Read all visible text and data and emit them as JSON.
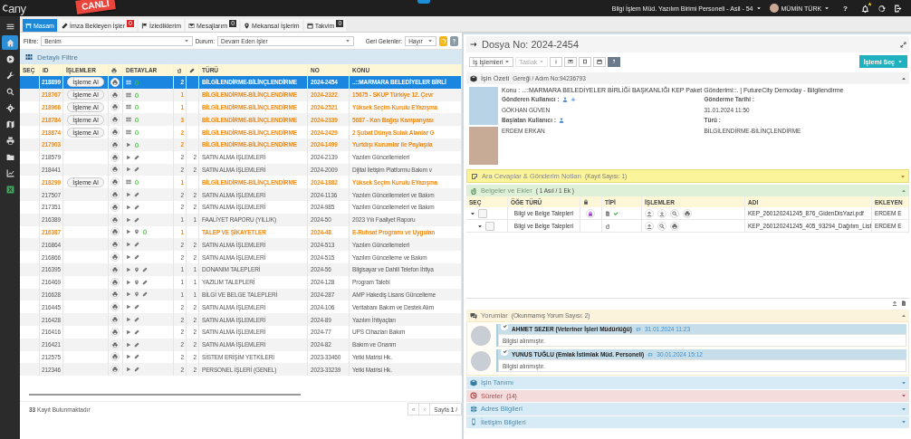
{
  "top_bar": {
    "logo_text": "any",
    "live_badge": "CANLI",
    "role": "Bilgi İşlem Müd. Yazılım Birimi Personeli - Asil - 54",
    "user": "MÜMİN TÜRK",
    "help": "?"
  },
  "sidebar": {
    "items": [
      {
        "kind": "menu",
        "selected": false
      },
      {
        "kind": "home",
        "selected": true
      },
      {
        "kind": "playc",
        "selected": false
      },
      {
        "kind": "wrench",
        "selected": false
      },
      {
        "kind": "search",
        "selected": false
      },
      {
        "kind": "gear",
        "selected": false
      },
      {
        "kind": "map",
        "selected": false
      },
      {
        "kind": "print",
        "selected": false
      },
      {
        "kind": "folder",
        "selected": false
      },
      {
        "kind": "chart",
        "selected": false
      },
      {
        "kind": "excel",
        "selected": false
      }
    ]
  },
  "tabs": [
    {
      "kind": "desk",
      "label": "Masam",
      "selected": true
    },
    {
      "kind": "pen",
      "label": "İmza Bekleyen İşler",
      "selected": false,
      "badge": {
        "text": "0",
        "color": "#e02424"
      }
    },
    {
      "kind": "flag",
      "label": "İzlediklerim",
      "selected": false
    },
    {
      "kind": "mail",
      "label": "Mesajlarım",
      "selected": false,
      "badge": {
        "text": "0",
        "color": "#333333"
      }
    },
    {
      "kind": "pin",
      "label": "Mekansal İşlerim",
      "selected": false
    },
    {
      "kind": "calendar",
      "label": "Takvim",
      "selected": false,
      "badge": {
        "text": "0",
        "color": "#333333"
      }
    }
  ],
  "filters": [
    {
      "label": "Filtre:",
      "value": "Benim"
    },
    {
      "label": "Durum:",
      "value": "Devam Eden İşler"
    },
    {
      "label": "Geri Gelenler:",
      "value": "Hayır"
    }
  ],
  "detail_filter": "Detaylı Filtre",
  "table": {
    "columns": [
      {
        "label": "SEÇ"
      },
      {
        "label": "ID"
      },
      {
        "label": "İŞLEMLER"
      },
      {
        "kind": "print"
      },
      {
        "label": "DETAYLAR"
      },
      {
        "kind": "clip"
      },
      {
        "kind": "pencil"
      },
      {
        "label": "TÜRÜ"
      },
      {
        "label": "NO"
      },
      {
        "label": "KONU"
      }
    ],
    "rows": [
      {
        "id": "218899",
        "action": "İşleme Al",
        "icons": [
          {
            "kind": "grid"
          },
          {
            "kind": "bell"
          }
        ],
        "count_1": "2",
        "type": "BİLGİLENDİRME-BİLİNÇLENDİRME",
        "no": "2024-2454",
        "subject": "..::MARMARA BELEDİYELER BİRLİ",
        "highlighted": true,
        "selected": true
      },
      {
        "id": "218767",
        "action": "İşleme Al",
        "icons": [
          {
            "kind": "grid"
          },
          {
            "kind": "bell"
          }
        ],
        "count_1": "1",
        "type": "BİLGİLENDİRME-BİLİNÇLENDİRME",
        "no": "2024-2322",
        "subject": "15675 - SKUP Türkiye 12. Çevr",
        "highlighted": true,
        "selected": false
      },
      {
        "id": "218966",
        "action": "İşleme Al",
        "icons": [
          {
            "kind": "grid"
          },
          {
            "kind": "bell"
          }
        ],
        "count_1": "1",
        "type": "BİLGİLENDİRME-BİLİNÇLENDİRME",
        "no": "2024-2521",
        "subject": "Yüksek Seçim Kurulu EYazışma",
        "highlighted": true,
        "selected": false
      },
      {
        "id": "218784",
        "action": "İşleme Al",
        "icons": [
          {
            "kind": "grid"
          },
          {
            "kind": "bell"
          }
        ],
        "count_1": "3",
        "type": "BİLGİLENDİRME-BİLİNÇLENDİRME",
        "no": "2024-2339",
        "subject": "5687 - Kan Bağışı Kampanyası",
        "highlighted": true,
        "selected": false
      },
      {
        "id": "218874",
        "action": "İşleme Al",
        "icons": [
          {
            "kind": "grid"
          },
          {
            "kind": "bell"
          }
        ],
        "count_1": "2",
        "type": "BİLGİLENDİRME-BİLİNÇLENDİRME",
        "no": "2024-2429",
        "subject": "2 Şubat Dünya Sulak Alanlar G",
        "highlighted": true,
        "selected": false
      },
      {
        "id": "217903",
        "icons": [
          {
            "kind": "play"
          },
          {
            "kind": "bell"
          }
        ],
        "count_1": "2",
        "type": "BİLGİLENDİRME-BİLİNÇLENDİRME",
        "no": "2024-1499",
        "subject": "Yurtdışı Kurumlar ile Paylaşıla",
        "highlighted": true,
        "selected": false
      },
      {
        "id": "218579",
        "icons": [
          {
            "kind": "play"
          },
          {
            "kind": "pencil"
          }
        ],
        "count_1": "2",
        "count_2": "2",
        "type": "SATIN ALMA İŞLEMLERİ",
        "no": "2024-2139",
        "subject": "Yazılım Güncellemeleri",
        "highlighted": false,
        "selected": false
      },
      {
        "id": "218441",
        "icons": [
          {
            "kind": "play"
          },
          {
            "kind": "pencil"
          }
        ],
        "count_1": "2",
        "count_2": "2",
        "type": "SATIN ALMA İŞLEMLERİ",
        "no": "2024-2009",
        "subject": "Dijital İletişim Platformu Bakım v",
        "highlighted": false,
        "selected": false
      },
      {
        "id": "218299",
        "action": "İşleme Al",
        "icons": [
          {
            "kind": "grid"
          },
          {
            "kind": "bell"
          }
        ],
        "count_1": "1",
        "type": "BİLGİLENDİRME-BİLİNÇLENDİRME",
        "no": "2024-1882",
        "subject": "Yüksek Seçim Kurulu EYazışma",
        "highlighted": true,
        "selected": false
      },
      {
        "id": "217507",
        "icons": [
          {
            "kind": "play"
          },
          {
            "kind": "pencil"
          }
        ],
        "count_1": "2",
        "count_2": "2",
        "type": "SATIN ALMA İŞLEMLERİ",
        "no": "2024-1136",
        "subject": "Yazılım Güncellemeleri ve Bakım",
        "highlighted": false,
        "selected": false
      },
      {
        "id": "217351",
        "icons": [
          {
            "kind": "play"
          },
          {
            "kind": "pencil"
          }
        ],
        "count_1": "2",
        "count_2": "2",
        "type": "SATIN ALMA İŞLEMLERİ",
        "no": "2024-985",
        "subject": "Yazılım Güncellemeleri ve Bakım",
        "highlighted": false,
        "selected": false
      },
      {
        "id": "216389",
        "icons": [
          {
            "kind": "play"
          },
          {
            "kind": "pencil"
          }
        ],
        "count_1": "1",
        "count_2": "1",
        "type": "FAALİYET RAPORU (YILLIK)",
        "no": "2024-50",
        "subject": "2023 Yılı Faaliyet Raporu",
        "highlighted": false,
        "selected": false
      },
      {
        "id": "216387",
        "icons": [
          {
            "kind": "play"
          },
          {
            "kind": "pin"
          },
          {
            "kind": "bell"
          }
        ],
        "count_1": "1",
        "type": "TALEP VE ŞİKAYETLER",
        "no": "2024-48",
        "subject": "E-Ruhsat Programı ve Uygulan",
        "highlighted": true,
        "selected": false
      },
      {
        "id": "216864",
        "icons": [
          {
            "kind": "play"
          },
          {
            "kind": "pencil"
          }
        ],
        "count_1": "2",
        "count_2": "2",
        "type": "SATIN ALMA İŞLEMLERİ",
        "no": "2024-513",
        "subject": "Yazılım Güncellemeleri",
        "highlighted": false,
        "selected": false
      },
      {
        "id": "216866",
        "icons": [
          {
            "kind": "play"
          },
          {
            "kind": "pencil"
          }
        ],
        "count_1": "2",
        "count_2": "2",
        "type": "SATIN ALMA İŞLEMLERİ",
        "no": "2024-515",
        "subject": "Yazılım Güncelleme ve Bakım",
        "highlighted": false,
        "selected": false
      },
      {
        "id": "216395",
        "icons": [
          {
            "kind": "play"
          },
          {
            "kind": "pin"
          },
          {
            "kind": "pencil"
          }
        ],
        "count_1": "1",
        "count_2": "1",
        "type": "DONANIM TALEPLERİ",
        "no": "2024-56",
        "subject": "Bilgisayar ve Dahili Telefon İhtiya",
        "highlighted": false,
        "selected": false
      },
      {
        "id": "216469",
        "icons": [
          {
            "kind": "play"
          },
          {
            "kind": "pin"
          },
          {
            "kind": "pencil"
          }
        ],
        "count_1": "1",
        "count_2": "1",
        "type": "YAZILIM TALEPLERİ",
        "no": "2024-128",
        "subject": "Program Talebi",
        "highlighted": false,
        "selected": false
      },
      {
        "id": "216628",
        "icons": [
          {
            "kind": "play"
          },
          {
            "kind": "pin"
          },
          {
            "kind": "pencil"
          }
        ],
        "count_1": "1",
        "count_2": "1",
        "type": "BİLGİ VE BELGE TALEPLERİ",
        "no": "2024-287",
        "subject": "AMP Hakediş Lisans Güncelleme",
        "highlighted": false,
        "selected": false
      },
      {
        "id": "216445",
        "icons": [
          {
            "kind": "play"
          },
          {
            "kind": "pencil"
          }
        ],
        "count_1": "2",
        "count_2": "2",
        "type": "SATIN ALMA İŞLEMLERİ",
        "no": "2024-106",
        "subject": "Veritabanı Bakım ve Destek Alım",
        "highlighted": false,
        "selected": false
      },
      {
        "id": "216428",
        "icons": [
          {
            "kind": "play"
          },
          {
            "kind": "pencil"
          }
        ],
        "count_1": "2",
        "count_2": "2",
        "type": "SATIN ALMA İŞLEMLERİ",
        "no": "2024-89",
        "subject": "Yazılım İhtiyaçları",
        "highlighted": false,
        "selected": false
      },
      {
        "id": "216416",
        "icons": [
          {
            "kind": "play"
          },
          {
            "kind": "pencil"
          }
        ],
        "count_1": "2",
        "count_2": "2",
        "type": "SATIN ALMA İŞLEMLERİ",
        "no": "2024-77",
        "subject": "UPS Cihazları Bakım",
        "highlighted": false,
        "selected": false
      },
      {
        "id": "216421",
        "icons": [
          {
            "kind": "play"
          },
          {
            "kind": "pencil"
          }
        ],
        "count_1": "2",
        "count_2": "2",
        "type": "SATIN ALMA İŞLEMLERİ",
        "no": "2024-82",
        "subject": "Bakım ve Onarım",
        "highlighted": false,
        "selected": false
      },
      {
        "id": "212575",
        "icons": [
          {
            "kind": "play"
          },
          {
            "kind": "pencil"
          }
        ],
        "count_1": "2",
        "count_2": "2",
        "type": "SİSTEM ERİŞİM YETKİLERİ",
        "no": "2023-33460",
        "subject": "Yetki Matrisi Hk.",
        "highlighted": false,
        "selected": false
      },
      {
        "id": "212346",
        "icons": [
          {
            "kind": "play"
          },
          {
            "kind": "pencil"
          }
        ],
        "count_1": "2",
        "count_2": "2",
        "type": "PERSONEL İŞLERİ (GENEL)",
        "no": "2023-33239",
        "subject": "Yetki Matrisi Hk.",
        "highlighted": false,
        "selected": false
      }
    ]
  },
  "footer": {
    "count": "**33** Kayıt Bulunmaktadır",
    "pager": [
      "«",
      "‹"
    ],
    "page": "Sayfa **1** /"
  },
  "detail": {
    "title": "Dosya No: 2024-2454",
    "toolbar": [
      {
        "kind": "dropdown",
        "label": "İş İşlemleri",
        "disabled": false
      },
      {
        "kind": "dropdown",
        "label": "Taslak",
        "disabled": true
      },
      {
        "kind": "info",
        "disabled": false
      },
      {
        "kind": "mail",
        "disabled": false
      },
      {
        "kind": "square",
        "disabled": false
      },
      {
        "kind": "calendar",
        "disabled": false
      },
      {
        "kind": "help",
        "disabled": false
      }
    ],
    "primary": "İşlemi Seç",
    "summary": {
      "title": "İşin Özeti",
      "subtitle": "Gereği / Adım No:94236793",
      "subject": "Konu : ..::MARMARA BELEDİYELER BİRLİĞİ BAŞKANLIĞI KEP Paket Gönderimi::. | FutureCity Demoday - Bilgilendirme",
      "fields": [
        {
          "label": "Gönderen Kullanıcı :",
          "icons": [
            {
              "kind": "user"
            },
            {
              "kind": "plus"
            }
          ],
          "value": "GÖKHAN GÜVEN"
        },
        {
          "label": "Gönderme Tarihi :",
          "value": "31.01.2024 11:50"
        },
        {
          "label": "Başlatan Kullanıcı :",
          "icons": [
            {
              "kind": "user"
            }
          ],
          "value": "ERDEM ERKAN"
        },
        {
          "label": "Türü :",
          "value": "BİLGİLENDİRME-BİLİNÇLENDİRME"
        }
      ]
    },
    "notes": {
      "title": "Ara Cevaplar & Gönderim Notları",
      "count": "(Kayıt Sayısı: 1)"
    },
    "documents": {
      "title": "Belgeler ve Ekler",
      "count": "( 1 Asıl / 1 Ek )",
      "columns": [
        {
          "label": "SEÇ"
        },
        {
          "label": "ÖĞE TÜRÜ"
        },
        {
          "kind": "lock"
        },
        {
          "label": "TİPİ"
        },
        {
          "label": "İŞLEMLER"
        },
        {
          "label": "ADI"
        },
        {
          "label": "EKLEYEN"
        }
      ],
      "rows": [
        {
          "expanded": true,
          "checked": false,
          "type": "Bilgi ve Belge Talepleri",
          "locked": true,
          "type_icons": [
            {
              "kind": "doc"
            },
            {
              "kind": "check"
            }
          ],
          "actions": [
            {
              "kind": "upload"
            },
            {
              "kind": "download"
            },
            {
              "kind": "search"
            },
            {
              "kind": "print"
            }
          ],
          "name": "KEP_260120241245_876_GidenDisYazi.pdf",
          "added_by": "ERDEM E",
          "children": [
            {
              "expanded": true,
              "checked": false,
              "type": "Bilgi ve Belge Talepleri",
              "locked": false,
              "type_icons": [
                {
                  "kind": "clip"
                }
              ],
              "actions": [
                {
                  "kind": "upload"
                },
                {
                  "kind": "search"
                },
                {
                  "kind": "print"
                }
              ],
              "name": "KEP_260120241245_405_93294_Dağıtım_List",
              "added_by": "ERDEM E"
            }
          ]
        }
      ]
    },
    "comments": {
      "title": "Yorumlar",
      "count": "(Okunmamış Yorum Sayısı: 2)",
      "items": [
        {
          "author": "AHMET SEZER (Veteriner İşleri Müdürlüğü)",
          "date": "31.01.2024 11:23",
          "text": "Bilgisi alınmıştır."
        },
        {
          "author": "YUNUS TUĞLU (Emlak İstimlak Müd. Personeli)",
          "date": "30.01.2024 15:12",
          "text": "Bilgisi alınmıştır."
        }
      ]
    },
    "sections": [
      {
        "kind": "cube",
        "title": "İşin Tanımı",
        "color": "#d6ebf6"
      },
      {
        "kind": "clock",
        "title": "Süreler",
        "count": "(14)",
        "color": "#f4dcdc"
      },
      {
        "kind": "signpost",
        "title": "Adres Bilgileri",
        "color": "#d6ebf6"
      },
      {
        "kind": "phone",
        "title": "İletişim Bilgileri",
        "color": "#d6ebf6"
      }
    ]
  }
}
